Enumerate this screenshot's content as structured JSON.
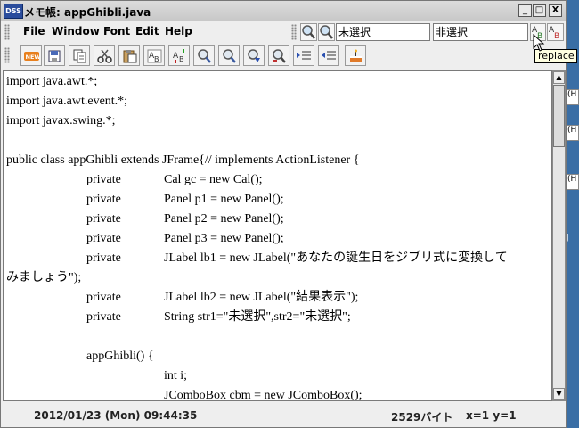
{
  "window": {
    "title": "メモ帳: appGhibli.java",
    "app_icon_text": "DSS"
  },
  "window_controls": {
    "minimize": "_",
    "maximize": "□",
    "close": "X"
  },
  "menu": [
    "File",
    "Window",
    "Font",
    "Edit",
    "Help"
  ],
  "search": {
    "find_value": "未選択",
    "replace_value": "非選択"
  },
  "toolbar": {
    "buttons": [
      {
        "name": "new-icon",
        "glyph": "NEW",
        "color": "#e8801e"
      },
      {
        "name": "open-icon"
      },
      {
        "name": "save-icon"
      },
      {
        "name": "cut-icon"
      },
      {
        "name": "paste-icon"
      },
      {
        "name": "font-ab-icon"
      },
      {
        "name": "font-size-icon"
      },
      {
        "name": "find-icon"
      },
      {
        "name": "find-next-icon"
      },
      {
        "name": "find-down-icon"
      },
      {
        "name": "find-replace-icon"
      },
      {
        "name": "indent-icon"
      },
      {
        "name": "outdent-icon"
      },
      {
        "name": "cake-icon"
      }
    ]
  },
  "editor": {
    "lines": [
      {
        "indent": 0,
        "text": "import java.awt.*;"
      },
      {
        "indent": 0,
        "text": "import java.awt.event.*;"
      },
      {
        "indent": 0,
        "text": "import javax.swing.*;"
      },
      {
        "indent": 0,
        "text": ""
      },
      {
        "indent": 0,
        "text": "public class appGhibli extends JFrame{// implements ActionListener {"
      },
      {
        "indent": 1,
        "text": "private",
        "rest": "Cal gc = new Cal();"
      },
      {
        "indent": 1,
        "text": "private",
        "rest": "Panel p1 = new Panel();"
      },
      {
        "indent": 1,
        "text": "private",
        "rest": "Panel p2 = new Panel();"
      },
      {
        "indent": 1,
        "text": "private",
        "rest": "Panel p3 = new Panel();"
      },
      {
        "indent": 1,
        "text": "private",
        "rest": "JLabel lb1 = new JLabel(\"あなたの誕生日をジブリ式に変換して"
      },
      {
        "indent": 0,
        "text": "みましょう\");"
      },
      {
        "indent": 1,
        "text": "private",
        "rest": "JLabel lb2 = new JLabel(\"結果表示\");"
      },
      {
        "indent": 1,
        "text": "private",
        "rest": "String str1=\"未選択\",str2=\"未選択\";"
      },
      {
        "indent": 0,
        "text": ""
      },
      {
        "indent": 1,
        "text": "appGhibli() {"
      },
      {
        "indent": 2,
        "text": "int i;"
      },
      {
        "indent": 2,
        "text": "JComboBox cbm = new JComboBox();"
      }
    ]
  },
  "status": {
    "datetime": "2012/01/23 (Mon) 09:44:35",
    "bytes": "2529バイト",
    "position": "x=1 y=1"
  },
  "tooltip": "replace",
  "desktop_peek": [
    "(H",
    "(H",
    "(H",
    "j"
  ]
}
